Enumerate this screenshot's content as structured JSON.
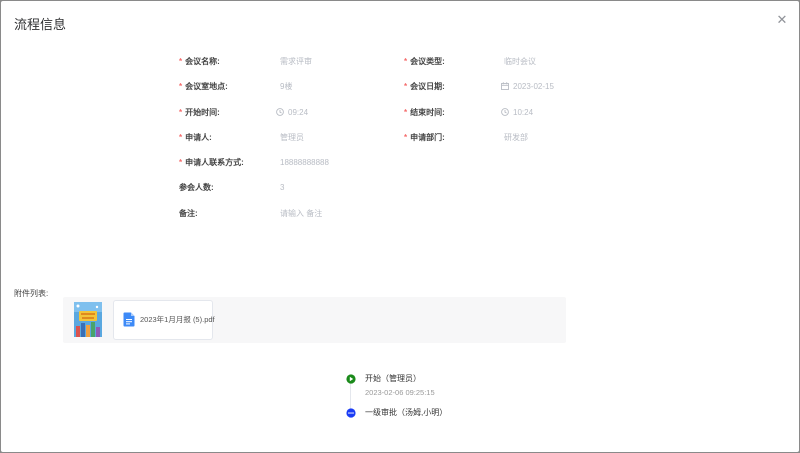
{
  "dialog": {
    "title": "流程信息"
  },
  "form": {
    "meeting_name": {
      "label": "会议名称:",
      "value": "需求评审",
      "required": true
    },
    "meeting_type": {
      "label": "会议类型:",
      "value": "临时会议",
      "required": true
    },
    "meeting_room": {
      "label": "会议室地点:",
      "value": "9楼",
      "required": true
    },
    "meeting_date": {
      "label": "会议日期:",
      "value": "2023-02-15",
      "required": true
    },
    "start_time": {
      "label": "开始时间:",
      "value": "09:24",
      "required": true
    },
    "end_time": {
      "label": "结束时间:",
      "value": "10:24",
      "required": true
    },
    "applicant": {
      "label": "申请人:",
      "value": "管理员",
      "required": true
    },
    "department": {
      "label": "申请部门:",
      "value": "研发部",
      "required": true
    },
    "contact": {
      "label": "申请人联系方式:",
      "value": "18888888888",
      "required": true
    },
    "attendees": {
      "label": "参会人数:",
      "value": "3"
    },
    "remark": {
      "label": "备注:",
      "placeholder": "请输入 备注"
    }
  },
  "attachments": {
    "label": "附件列表:",
    "files": [
      {
        "name": "2023年1月月报 (5).pdf"
      }
    ]
  },
  "timeline": [
    {
      "title": "开始（管理员）",
      "time": "2023-02-06 09:25:15",
      "status_color": "#1a8a1a"
    },
    {
      "title": "一级审批（汤姆,小明）",
      "status_color": "#1a3cf5"
    }
  ],
  "colors": {
    "required": "#f56c6c",
    "value": "#b8bcc4",
    "label": "#454545"
  },
  "icons": {
    "close": "close-icon",
    "clock": "clock-icon",
    "calendar": "calendar-icon",
    "file": "pdf-file-icon"
  }
}
